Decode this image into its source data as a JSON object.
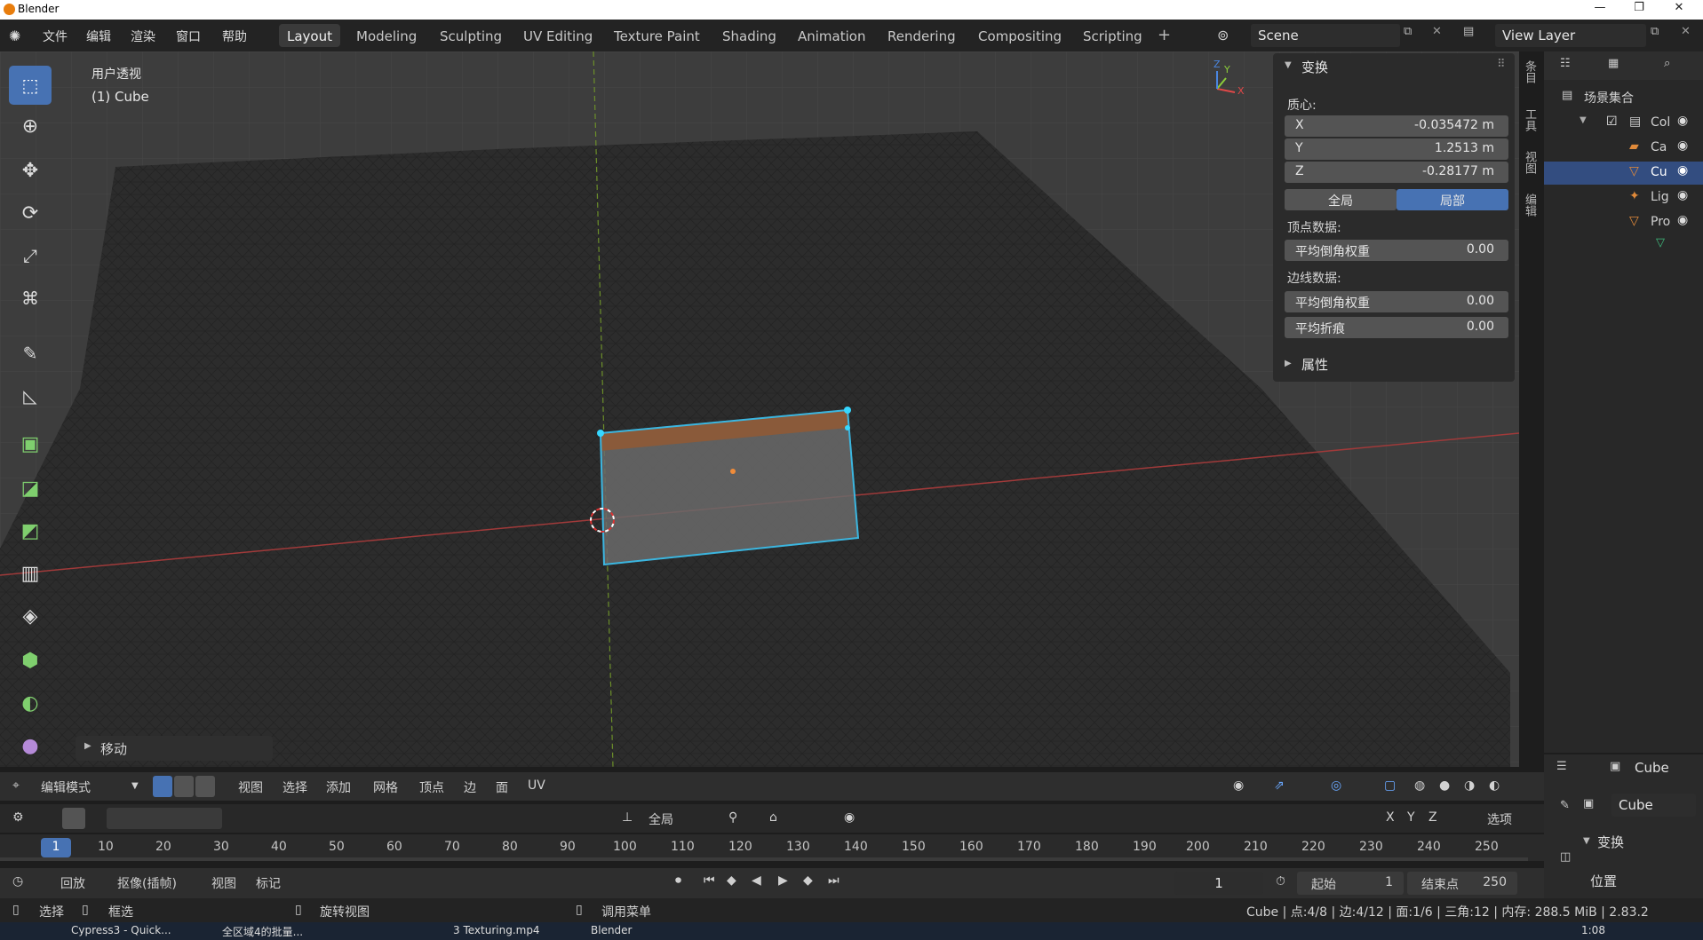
{
  "window": {
    "title": "Blender",
    "controls": [
      "—",
      "❐",
      "✕"
    ]
  },
  "menu": [
    "文件",
    "编辑",
    "渲染",
    "窗口",
    "帮助"
  ],
  "workspaces": [
    "Layout",
    "Modeling",
    "Sculpting",
    "UV Editing",
    "Texture Paint",
    "Shading",
    "Animation",
    "Rendering",
    "Compositing",
    "Scripting"
  ],
  "scene": {
    "name": "Scene",
    "view_layer": "View Layer"
  },
  "viewport": {
    "view_name": "用户透视",
    "object_label": "(1) Cube",
    "last_op": "移动",
    "axes": [
      "X",
      "Y",
      "Z"
    ]
  },
  "npanel": {
    "transform_title": "变换",
    "median_label": "质心:",
    "x_label": "X",
    "x_value": "-0.035472 m",
    "y_label": "Y",
    "y_value": "1.2513 m",
    "z_label": "Z",
    "z_value": "-0.28177 m",
    "global_btn": "全局",
    "local_btn": "局部",
    "vertex_data": "顶点数据:",
    "vertex_bevel_label": "平均倒角权重",
    "vertex_bevel_value": "0.00",
    "edge_data": "边线数据:",
    "edge_bevel_label": "平均倒角权重",
    "edge_bevel_value": "0.00",
    "crease_label": "平均折痕",
    "crease_value": "0.00",
    "attributes_title": "属性",
    "side_tabs": [
      "条目",
      "工具",
      "视图",
      "编辑"
    ]
  },
  "outliner": {
    "root": "场景集合",
    "rows": [
      {
        "label": "Col",
        "selected": false
      },
      {
        "label": "Ca",
        "selected": false
      },
      {
        "label": "Cu",
        "selected": true
      },
      {
        "label": "Lig",
        "selected": false
      },
      {
        "label": "Pro",
        "selected": false
      }
    ]
  },
  "props": {
    "object_name": "Cube",
    "mesh_name": "Cube",
    "section": "变换",
    "location_label": "位置"
  },
  "header": {
    "mode": "编辑模式",
    "menus": [
      "视图",
      "选择",
      "添加",
      "网格",
      "顶点",
      "边",
      "面",
      "UV"
    ],
    "orientation": "全局",
    "options": "选项",
    "axis_toggles": [
      "X",
      "Y",
      "Z"
    ]
  },
  "timeline": {
    "current_frame": "1",
    "ticks": [
      "10",
      "20",
      "30",
      "40",
      "50",
      "60",
      "70",
      "80",
      "90",
      "100",
      "110",
      "120",
      "130",
      "140",
      "150",
      "160",
      "170",
      "180",
      "190",
      "200",
      "210",
      "220",
      "230",
      "240",
      "250"
    ],
    "playback": "回放",
    "keying": "抠像(插帧)",
    "view": "视图",
    "marker": "标记",
    "frame": "1",
    "start_label": "起始",
    "start_value": "1",
    "end_label": "结束点",
    "end_value": "250"
  },
  "status": {
    "select": "选择",
    "box_select": "框选",
    "rotate_view": "旋转视图",
    "call_menu": "调用菜单",
    "stats": "Cube | 点:4/8 | 边:4/12 | 面:1/6 | 三角:12 | 内存: 288.5 MiB | 2.83.2"
  },
  "taskbar": {
    "items": [
      "Cypress3 - Quick...",
      "全区域4的批量...",
      "3 Texturing.mp4",
      "Blender"
    ],
    "clock": "1:08"
  }
}
